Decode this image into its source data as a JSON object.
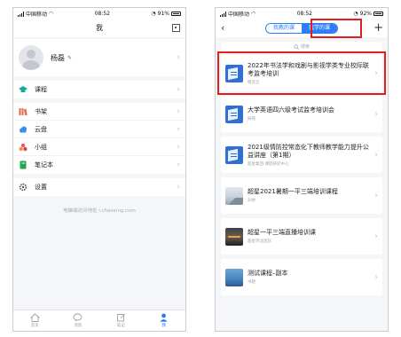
{
  "left_phone": {
    "status": {
      "carrier": "中国移动",
      "time": "08:52",
      "battery": "91%"
    },
    "nav_title": "我",
    "profile": {
      "name": "杨磊"
    },
    "menu_group_1": [
      {
        "label": "课程",
        "icon": "graduation-cap-icon",
        "color": "#1aa89a"
      }
    ],
    "menu_group_2": [
      {
        "label": "书架",
        "icon": "bookshelf-icon",
        "color": "#e56a4b"
      },
      {
        "label": "云盘",
        "icon": "cloud-icon",
        "color": "#3a8ef0"
      },
      {
        "label": "小组",
        "icon": "group-icon",
        "color": "#ea5c5c"
      },
      {
        "label": "笔记本",
        "icon": "notebook-icon",
        "color": "#1fa84d"
      }
    ],
    "menu_group_3": [
      {
        "label": "设置",
        "icon": "gear-icon",
        "color": "#555555"
      }
    ],
    "watermark": "电脑端访问地址 i.chaoxing.com",
    "tabbar": [
      {
        "label": "首页",
        "icon": "home-icon"
      },
      {
        "label": "消息",
        "icon": "message-icon"
      },
      {
        "label": "笔记",
        "icon": "edit-icon"
      },
      {
        "label": "我",
        "icon": "person-icon",
        "active": true
      }
    ]
  },
  "right_phone": {
    "status": {
      "carrier": "中国移动",
      "time": "08:52",
      "battery": "92%"
    },
    "segments": [
      {
        "label": "我教的课",
        "active": false
      },
      {
        "label": "我学的课",
        "active": true
      }
    ],
    "search_placeholder": "搜索",
    "courses": [
      {
        "title": "2022年书法学和戏剧与影视学类专业校际联考监考培训",
        "subtitle": "橙云云",
        "thumb": "doc",
        "highlighted": true
      },
      {
        "title": "大学英语四六级考试监考培训会",
        "subtitle": "振铭",
        "thumb": "doc"
      },
      {
        "title": "2021级情防控常态化下教师教学能力提升公益讲座（第1期）",
        "subtitle": "超星集团·课程研究中心",
        "thumb": "doc"
      },
      {
        "title": "超星2021暑期一平三端培训课程",
        "subtitle": "刘依",
        "thumb": "land"
      },
      {
        "title": "超星一平三端直播培训课",
        "subtitle": "超星河北团队",
        "thumb": "sunset"
      },
      {
        "title": "测试课程–副本",
        "subtitle": "书题",
        "thumb": "blue"
      }
    ]
  },
  "colors": {
    "accent": "#2e7cf6",
    "highlight_box": "#e31c1c"
  }
}
